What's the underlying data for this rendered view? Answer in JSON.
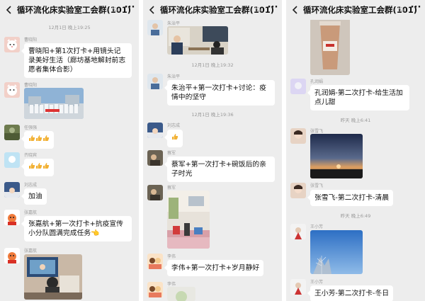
{
  "panels": [
    {
      "title": "循环流化床实验室工会群(101)",
      "timestamps": [
        "12月1日 晚上19:25"
      ],
      "messages": [
        {
          "sender": "曹晓阳",
          "text": "曹晓阳+第1次打卡+用镜头记录美好生活（廊坊基地解封前志愿者集体合影）"
        },
        {
          "sender": "曹晓阳",
          "type": "image"
        },
        {
          "sender": "任强强",
          "type": "emoji"
        },
        {
          "sender": "齐晓宾",
          "type": "emoji"
        },
        {
          "sender": "刘志成",
          "text": "加油"
        },
        {
          "sender": "张嘉航",
          "text": "张嘉航+第一次打卡+抗疫宣传小分队圆满完成任务👈"
        },
        {
          "sender": "张嘉航",
          "type": "image"
        }
      ]
    },
    {
      "title": "循环流化床实验室工会群(101)",
      "timestamps": [
        "12月1日 晚上19:32",
        "12月1日 晚上19:36"
      ],
      "messages": [
        {
          "sender": "朱治平",
          "type": "image"
        },
        {
          "sender": "朱治平",
          "text": "朱治平+第一次打卡+讨论：疫情中的坚守"
        },
        {
          "sender": "刘志成",
          "type": "emoji"
        },
        {
          "sender": "蔡军",
          "text": "蔡军+第一次打卡+碗饭后的亲子时光"
        },
        {
          "sender": "蔡军",
          "type": "image"
        },
        {
          "sender": "李伟",
          "text": "李伟+第一次打卡+岁月静好"
        },
        {
          "sender": "李伟",
          "type": "image"
        }
      ]
    },
    {
      "title": "循环流化床实验室工会群(101)",
      "timestamps": [
        "昨天 晚上6:41",
        "昨天 晚上6:49"
      ],
      "messages": [
        {
          "type": "image"
        },
        {
          "sender": "孔润娟",
          "text": "孔润娟-第二次打卡-给生活加点儿甜"
        },
        {
          "sender": "张雪飞",
          "type": "image"
        },
        {
          "sender": "张雪飞",
          "text": "张雪飞-第二次打卡-清晨"
        },
        {
          "sender": "王小芳",
          "type": "image"
        },
        {
          "sender": "王小芳",
          "text": "王小芳-第二次打卡-冬日"
        }
      ]
    }
  ],
  "icons": {
    "back": "chevron-left-icon",
    "mute": "bell-muted-icon",
    "more": "more-dots-icon",
    "more_glyph": "···",
    "thumbs_color": "#f2b134"
  }
}
